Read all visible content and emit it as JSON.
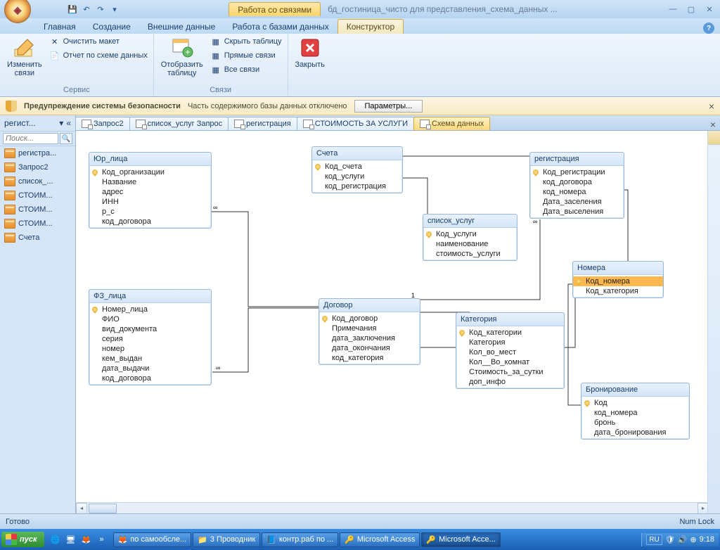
{
  "titlebar": {
    "context_label": "Работа со связями",
    "doc_title": "бд_гостиница_чисто для представления_схема_данных ..."
  },
  "ribbon_tabs": [
    "Главная",
    "Создание",
    "Внешние данные",
    "Работа с базами данных",
    "Конструктор"
  ],
  "active_ribbon_tab": 4,
  "ribbon": {
    "group1": {
      "big": "Изменить\nсвязи",
      "clear_layout": "Очистить макет",
      "report": "Отчет по схеме данных",
      "label": "Сервис"
    },
    "group2": {
      "show_table": "Отобразить\nтаблицу",
      "hide_table": "Скрыть таблицу",
      "direct": "Прямые связи",
      "all": "Все связи",
      "label": "Связи"
    },
    "group3": {
      "close": "Закрыть"
    }
  },
  "security": {
    "title": "Предупреждение системы безопасности",
    "msg": "Часть содержимого базы данных отключено",
    "btn": "Параметры..."
  },
  "nav": {
    "header": "регист...",
    "search_placeholder": "Поиск...",
    "items": [
      "регистра...",
      "Запрос2",
      "список_...",
      "СТОИМ...",
      "СТОИМ...",
      "СТОИМ...",
      "Счета"
    ]
  },
  "doc_tabs": [
    {
      "label": "Запрос2"
    },
    {
      "label": "список_услуг Запрос"
    },
    {
      "label": "регистрация"
    },
    {
      "label": "СТОИМОСТЬ ЗА УСЛУГИ"
    },
    {
      "label": "Схема данных",
      "active": true
    }
  ],
  "tables": {
    "yur": {
      "title": "Юр_лица",
      "fields": [
        "Код_организации",
        "Название",
        "адрес",
        "ИНН",
        "р_с",
        "код_договора"
      ],
      "pk": [
        0
      ]
    },
    "scheta": {
      "title": "Счета",
      "fields": [
        "Код_счета",
        "код_услуги",
        "код_регистрация"
      ],
      "pk": [
        0
      ]
    },
    "reg": {
      "title": "регистрация",
      "fields": [
        "Код_регистрации",
        "код_договора",
        "код_номера",
        "Дата_заселения",
        "Дата_выселения"
      ],
      "pk": [
        0
      ]
    },
    "spisok": {
      "title": "список_услуг",
      "fields": [
        "Код_услуги",
        "наименование",
        "стоимость_услуги"
      ],
      "pk": [
        0
      ]
    },
    "nomera": {
      "title": "Номера",
      "fields": [
        "Код_номера",
        "Код_категория"
      ],
      "pk": [
        0
      ],
      "sel": [
        0
      ]
    },
    "fz": {
      "title": "ФЗ_лица",
      "fields": [
        "Номер_лица",
        "ФИО",
        "вид_документа",
        "серия",
        "номер",
        "кем_выдан",
        "дата_выдачи",
        "код_договора"
      ],
      "pk": [
        0
      ]
    },
    "dogovor": {
      "title": "Договор",
      "fields": [
        "Код_договор",
        "Примечания",
        "дата_заключения",
        "дата_окончания",
        "код_категория"
      ],
      "pk": [
        0
      ]
    },
    "kategoria": {
      "title": "Категория",
      "fields": [
        "Код_категории",
        "Категория",
        "Кол_во_мест",
        "Кол__Во_комнат",
        "Стоимость_за_сутки",
        "доп_инфо"
      ],
      "pk": [
        0
      ]
    },
    "bron": {
      "title": "Бронирование",
      "fields": [
        "Код",
        "код_номера",
        "бронь",
        "дата_бронирования"
      ],
      "pk": [
        0
      ]
    }
  },
  "status": {
    "left": "Готово",
    "right": "Num Lock"
  },
  "taskbar": {
    "start": "пуск",
    "tasks": [
      {
        "label": "по самообсле..."
      },
      {
        "label": "3 Проводник"
      },
      {
        "label": "контр.раб по ..."
      },
      {
        "label": "Microsoft Access"
      },
      {
        "label": "Microsoft Acce...",
        "active": true
      }
    ],
    "lang": "RU",
    "time": "9:18"
  }
}
